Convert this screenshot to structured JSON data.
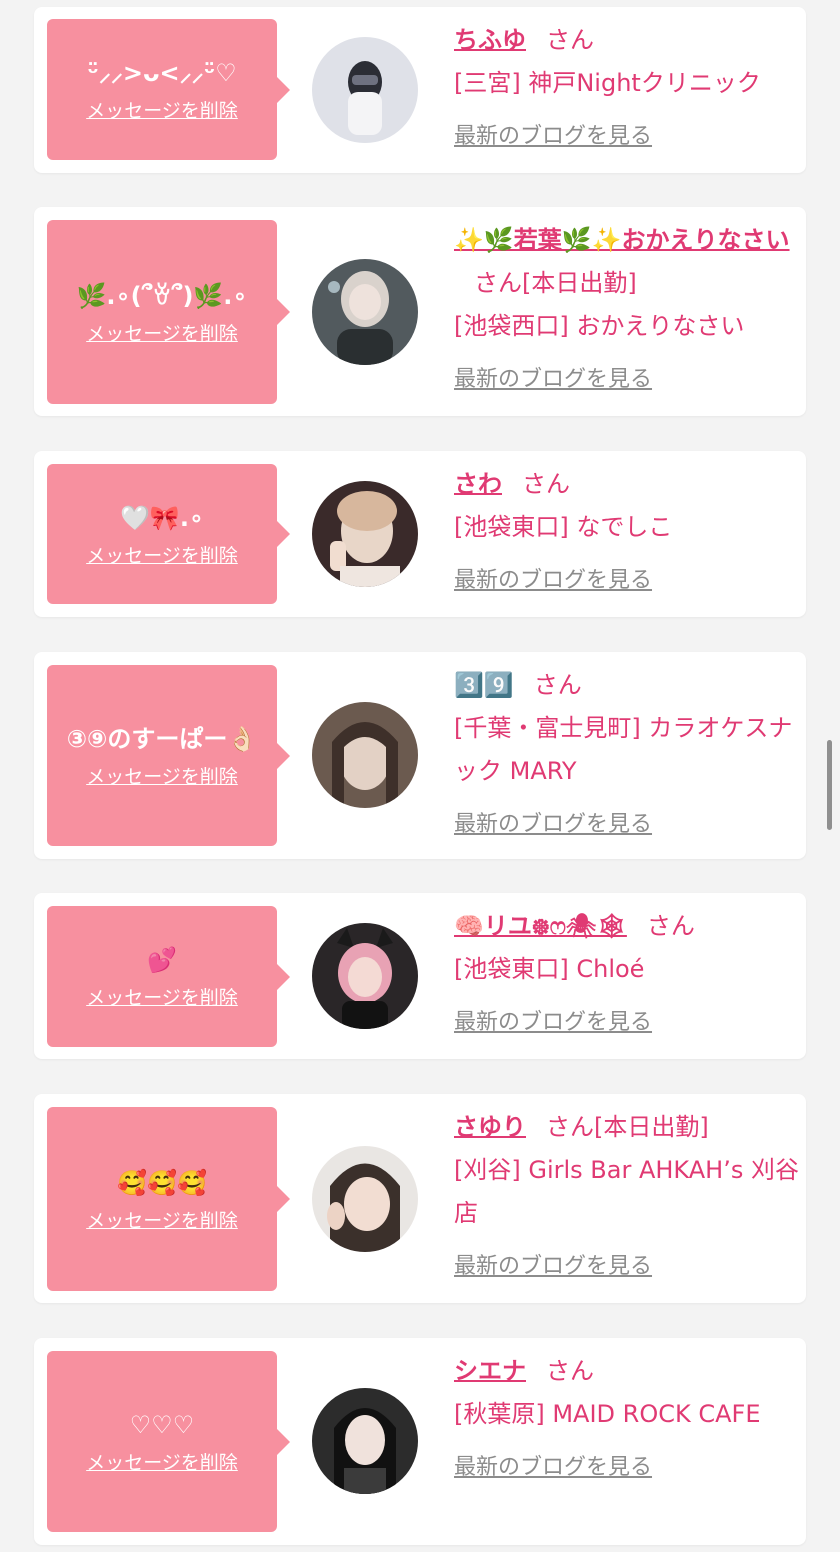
{
  "common": {
    "delete_label": "メッセージを削除",
    "san": "さん",
    "blog_label": "最新のブログを見る",
    "on_duty": "[本日出勤]"
  },
  "colors": {
    "bubble": "#f7909f",
    "accent": "#e03a73",
    "muted": "#8c8c8c"
  },
  "entries": [
    {
      "message": "ᵕ̈⸝⸝>ᴗ<⸝⸝ᵕ̈♡",
      "name": "ちふゆ",
      "shop": "[三宮] 神戸Nightクリニック",
      "on_duty": false
    },
    {
      "message": "🌿.∘(՞ꈊ՞)🌿.∘",
      "name": "✨🌿若葉🌿✨おかえりなさい",
      "shop": "[池袋西口] おかえりなさい",
      "on_duty": true
    },
    {
      "message": "🤍🎀.∘",
      "name": "さわ",
      "shop": "[池袋東口] なでしこ",
      "on_duty": false
    },
    {
      "message": "③⑨のすーぱー👌🏻",
      "name": "3️⃣9️⃣",
      "shop": "[千葉・富士見町] カラオケスナック MARY",
      "on_duty": false
    },
    {
      "message": "💕",
      "name": "🧠リユ᪥ෆ🕷🕸",
      "shop": "[池袋東口] Chloé",
      "on_duty": false
    },
    {
      "message": "🥰🥰🥰",
      "name": "さゆり",
      "shop": "[刈谷] Girls Bar AHKAH’s 刈谷店",
      "on_duty": true
    },
    {
      "message": "♡♡♡",
      "name": "シエナ",
      "shop": "[秋葉原] MAID ROCK CAFE",
      "on_duty": false
    }
  ]
}
